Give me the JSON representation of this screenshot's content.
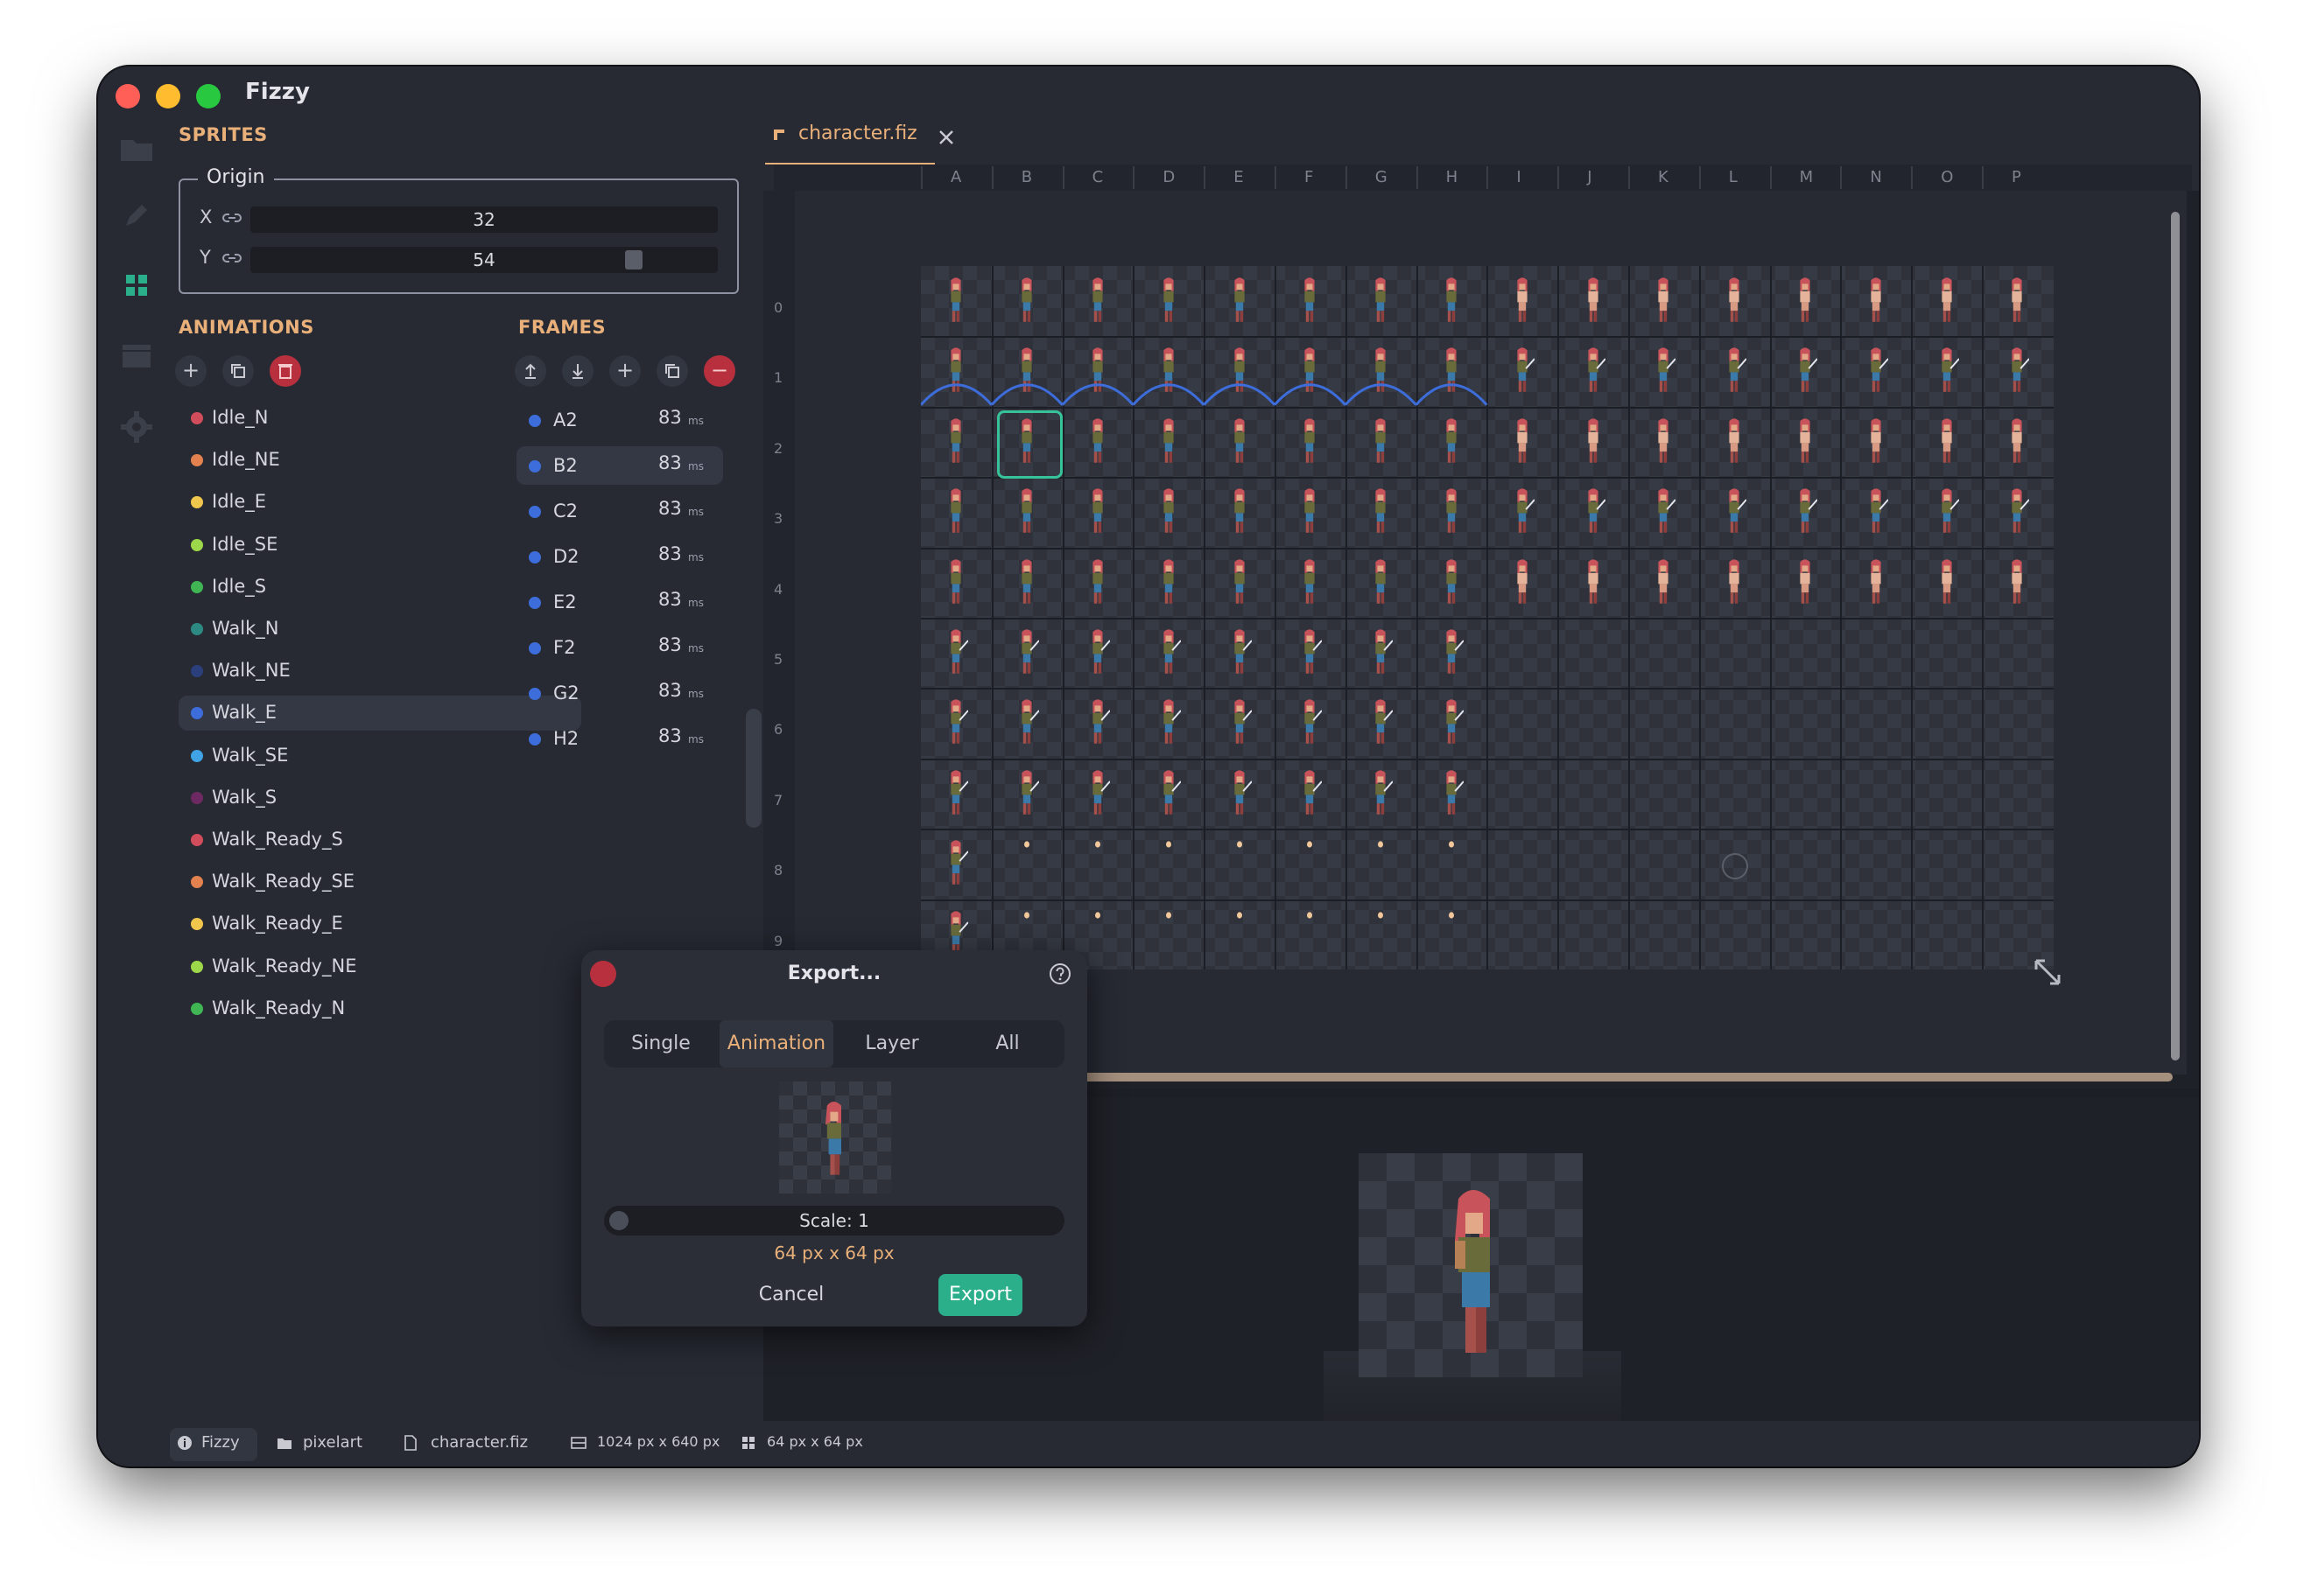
{
  "app": {
    "title": "Fizzy"
  },
  "rail": [
    "folder-icon",
    "pencil-icon",
    "grid-icon",
    "layers-icon",
    "gear-icon"
  ],
  "sprites": {
    "heading": "SPRITES",
    "origin_label": "Origin",
    "x_label": "X",
    "x_value": "32",
    "y_label": "Y",
    "y_value": "54"
  },
  "animations": {
    "heading": "ANIMATIONS",
    "selected": "Walk_E",
    "items": [
      {
        "label": "Idle_N",
        "color": "#d14d5b"
      },
      {
        "label": "Idle_NE",
        "color": "#e3824f"
      },
      {
        "label": "Idle_E",
        "color": "#f0c64c"
      },
      {
        "label": "Idle_SE",
        "color": "#9dd84a"
      },
      {
        "label": "Idle_S",
        "color": "#3fb653"
      },
      {
        "label": "Walk_N",
        "color": "#2c8a83"
      },
      {
        "label": "Walk_NE",
        "color": "#2a3f7c"
      },
      {
        "label": "Walk_E",
        "color": "#3d6ddb"
      },
      {
        "label": "Walk_SE",
        "color": "#3fa3e6"
      },
      {
        "label": "Walk_S",
        "color": "#6d2a62"
      },
      {
        "label": "Walk_Ready_S",
        "color": "#d14d5b"
      },
      {
        "label": "Walk_Ready_SE",
        "color": "#e3824f"
      },
      {
        "label": "Walk_Ready_E",
        "color": "#f0c64c"
      },
      {
        "label": "Walk_Ready_NE",
        "color": "#9dd84a"
      },
      {
        "label": "Walk_Ready_N",
        "color": "#3fb653"
      }
    ]
  },
  "frames": {
    "heading": "FRAMES",
    "selected": "B2",
    "unit": "ms",
    "items": [
      {
        "label": "A2",
        "ms": "83"
      },
      {
        "label": "B2",
        "ms": "83"
      },
      {
        "label": "C2",
        "ms": "83"
      },
      {
        "label": "D2",
        "ms": "83"
      },
      {
        "label": "E2",
        "ms": "83"
      },
      {
        "label": "F2",
        "ms": "83"
      },
      {
        "label": "G2",
        "ms": "83"
      },
      {
        "label": "H2",
        "ms": "83"
      }
    ]
  },
  "editor": {
    "tab_label": "character.fiz",
    "columns": [
      "A",
      "B",
      "C",
      "D",
      "E",
      "F",
      "G",
      "H",
      "I",
      "J",
      "K",
      "L",
      "M",
      "N",
      "O",
      "P"
    ],
    "rows": [
      "0",
      "1",
      "2",
      "3",
      "4",
      "5",
      "6",
      "7",
      "8",
      "9"
    ],
    "selected_cell": "B2"
  },
  "export_dialog": {
    "title": "Export...",
    "tabs": [
      "Single",
      "Animation",
      "Layer",
      "All"
    ],
    "selected_tab": "Animation",
    "scale_label": "Scale: 1",
    "size_label": "64 px x 64 px",
    "cancel_label": "Cancel",
    "export_label": "Export"
  },
  "status": {
    "app": "Fizzy",
    "folder": "pixelart",
    "file": "character.fiz",
    "canvas_size": "1024 px x 640 px",
    "tile_size": "64 px x 64 px"
  },
  "colors": {
    "accent": "#e9b07a",
    "export_button": "#2bae8a",
    "selection_outline": "#37c39a",
    "close_dot": "#b8303e"
  }
}
